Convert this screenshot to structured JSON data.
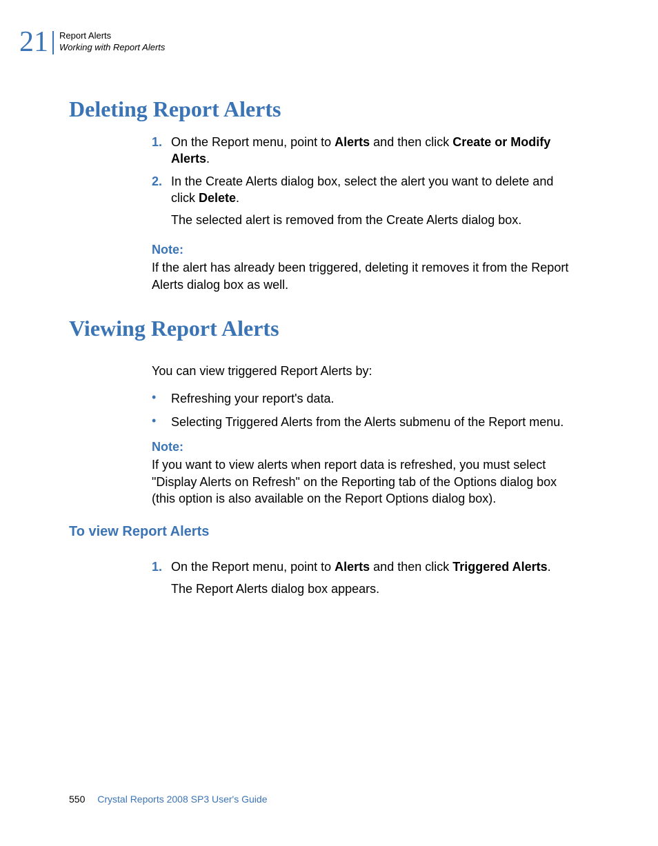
{
  "header": {
    "chapter_number": "21",
    "chapter_title": "Report Alerts",
    "section_title": "Working with Report Alerts"
  },
  "section1": {
    "heading": "Deleting Report Alerts",
    "step1_num": "1.",
    "step1_pre": "On the Report menu, point to ",
    "step1_b1": "Alerts",
    "step1_mid": " and then click ",
    "step1_b2": "Create or Modify Alerts",
    "step1_post": ".",
    "step2_num": "2.",
    "step2_pre": "In the Create Alerts dialog box, select the alert you want to delete and click ",
    "step2_b1": "Delete",
    "step2_post": ".",
    "step2_result": "The selected alert is removed from the Create Alerts dialog box.",
    "note_label": "Note:",
    "note_text": "If the alert has already been triggered, deleting it removes it from the Report Alerts dialog box as well."
  },
  "section2": {
    "heading": "Viewing Report Alerts",
    "intro": "You can view triggered Report Alerts by:",
    "bullet1": "Refreshing your report's data.",
    "bullet2": "Selecting Triggered Alerts from the Alerts submenu of the Report menu.",
    "note_label": "Note:",
    "note_text": "If you want to view alerts when report data is refreshed, you must select \"Display Alerts on Refresh\" on the Reporting tab of the Options dialog box (this option is also available on the Report Options dialog box).",
    "subheading": "To view Report Alerts",
    "step1_num": "1.",
    "step1_pre": "On the Report menu, point to ",
    "step1_b1": "Alerts",
    "step1_mid": " and then click ",
    "step1_b2": "Triggered Alerts",
    "step1_post": ".",
    "step1_result": "The Report Alerts dialog box appears."
  },
  "footer": {
    "page_number": "550",
    "title": "Crystal Reports 2008 SP3 User's Guide"
  }
}
